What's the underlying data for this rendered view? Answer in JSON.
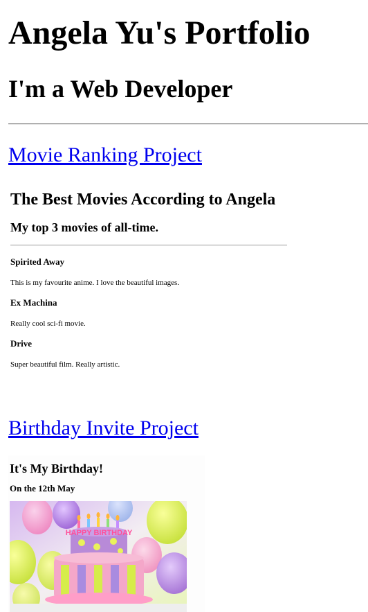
{
  "header": {
    "title": "Angela Yu's Portfolio",
    "subtitle": "I'm a Web Developer"
  },
  "projects": {
    "movie": {
      "link_label": "Movie Ranking Project",
      "page_title": "The Best Movies According to Angela",
      "page_subtitle": "My top 3 movies of all-time.",
      "movies": [
        {
          "title": "Spirited Away",
          "description": "This is my favourite anime. I love the beautiful images."
        },
        {
          "title": "Ex Machina",
          "description": "Really cool sci-fi movie."
        },
        {
          "title": "Drive",
          "description": "Super beautiful film. Really artistic."
        }
      ]
    },
    "birthday": {
      "link_label": "Birthday Invite Project",
      "page_title": "It's My Birthday!",
      "date_line": "On the 12th May",
      "cake_text": "HAPPY BIRTHDAY"
    }
  },
  "colors": {
    "link": "#0000ee",
    "text": "#000000",
    "background": "#ffffff"
  }
}
